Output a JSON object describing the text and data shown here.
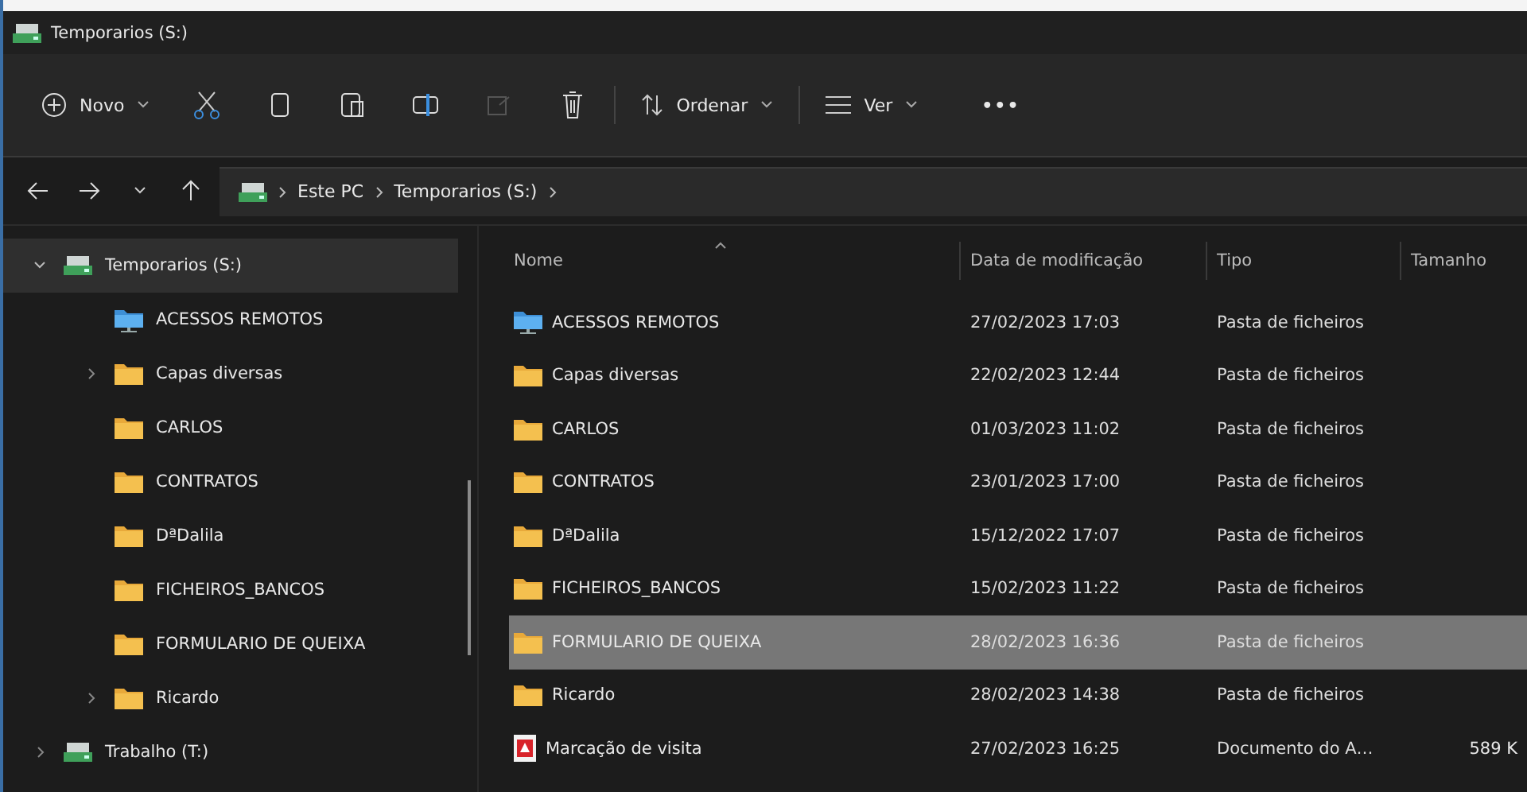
{
  "window": {
    "title": "Temporarios (S:)"
  },
  "toolbar": {
    "new": "Novo",
    "sort": "Ordenar",
    "view": "Ver",
    "more": "•••"
  },
  "address": {
    "crumbs": [
      "Este PC",
      "Temporarios (S:)"
    ]
  },
  "sidebar": {
    "items": [
      {
        "label": "Temporarios (S:)",
        "kind": "drive",
        "expanded": true,
        "selected": true,
        "children": [
          {
            "label": "ACESSOS REMOTOS",
            "kind": "network",
            "selected": false
          },
          {
            "label": "Capas diversas",
            "kind": "folder",
            "expanded": false,
            "selected": false
          },
          {
            "label": "CARLOS",
            "kind": "folder",
            "selected": false
          },
          {
            "label": "CONTRATOS",
            "kind": "folder",
            "selected": false
          },
          {
            "label": "DªDalila",
            "kind": "folder",
            "selected": false
          },
          {
            "label": "FICHEIROS_BANCOS",
            "kind": "folder",
            "selected": false
          },
          {
            "label": "FORMULARIO DE QUEIXA",
            "kind": "folder",
            "selected": false
          },
          {
            "label": "Ricardo",
            "kind": "folder",
            "expanded": false,
            "selected": false
          }
        ]
      },
      {
        "label": "Trabalho (T:)",
        "kind": "drive",
        "expanded": false,
        "selected": false
      }
    ]
  },
  "table": {
    "columns": [
      "Nome",
      "Data de modificação",
      "Tipo",
      "Tamanho"
    ],
    "rows": [
      {
        "name": "ACESSOS REMOTOS",
        "kind": "network",
        "date": "27/02/2023 17:03",
        "type": "Pasta de ficheiros",
        "selected": false
      },
      {
        "name": "Capas diversas",
        "kind": "folder",
        "date": "22/02/2023 12:44",
        "type": "Pasta de ficheiros",
        "selected": false
      },
      {
        "name": "CARLOS",
        "kind": "folder",
        "date": "01/03/2023 11:02",
        "type": "Pasta de ficheiros",
        "selected": false
      },
      {
        "name": "CONTRATOS",
        "kind": "folder",
        "date": "23/01/2023 17:00",
        "type": "Pasta de ficheiros",
        "selected": false
      },
      {
        "name": "DªDalila",
        "kind": "folder",
        "date": "15/12/2022 17:07",
        "type": "Pasta de ficheiros",
        "selected": false
      },
      {
        "name": "FICHEIROS_BANCOS",
        "kind": "folder",
        "date": "15/02/2023 11:22",
        "type": "Pasta de ficheiros",
        "selected": false
      },
      {
        "name": "FORMULARIO DE QUEIXA",
        "kind": "folder",
        "date": "28/02/2023 16:36",
        "type": "Pasta de ficheiros",
        "selected": true
      },
      {
        "name": "Ricardo",
        "kind": "folder",
        "date": "28/02/2023 14:38",
        "type": "Pasta de ficheiros",
        "selected": false
      },
      {
        "name": "Marcação de visita",
        "kind": "pdf",
        "date": "27/02/2023 16:25",
        "type": "Documento do A…",
        "size": "589 K",
        "selected": false
      }
    ]
  }
}
